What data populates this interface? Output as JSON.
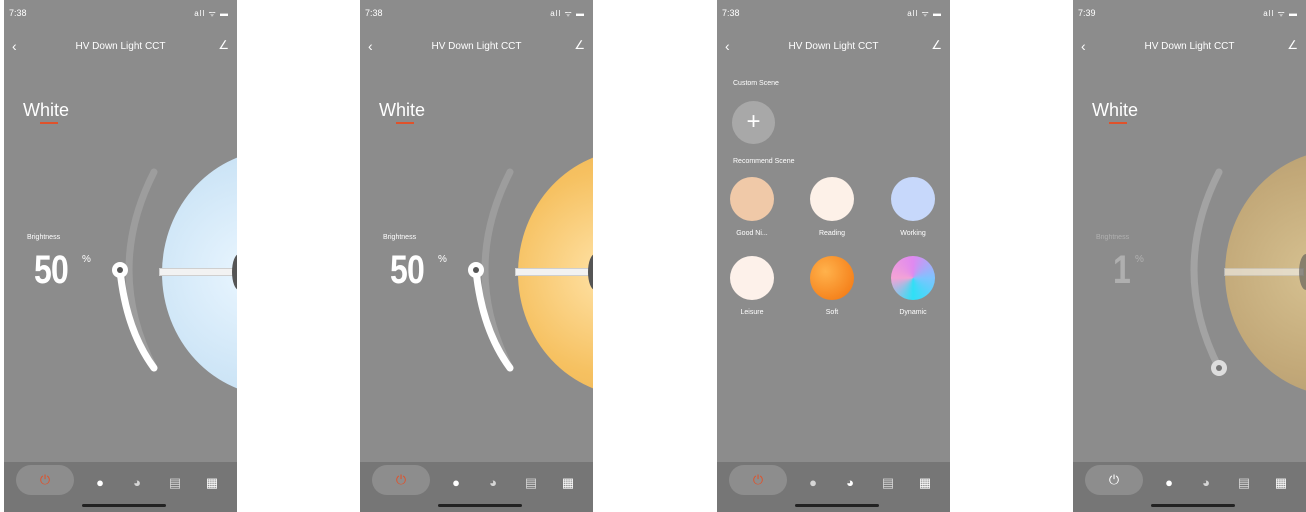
{
  "screens": [
    {
      "status": {
        "time": "7:38",
        "icons": "all ᯤ ▬"
      },
      "nav": {
        "back": "‹",
        "title": "HV  Down Light  CCT",
        "edit": "∠"
      },
      "mode": "White",
      "brightness": {
        "label": "Brightness",
        "value": "50",
        "unit": "%"
      },
      "bulb_color": "#d9ecf8",
      "tabs": [
        "power-icon",
        "bulb-icon",
        "palette-icon",
        "schedule-icon",
        "grid-icon"
      ]
    },
    {
      "status": {
        "time": "7:38",
        "icons": "all ᯤ ▬"
      },
      "nav": {
        "back": "‹",
        "title": "HV  Down Light  CCT",
        "edit": "∠"
      },
      "mode": "White",
      "brightness": {
        "label": "Brightness",
        "value": "50",
        "unit": "%"
      },
      "bulb_color": "#f8c96e",
      "tabs": [
        "power-icon",
        "bulb-icon",
        "palette-icon",
        "schedule-icon",
        "grid-icon"
      ]
    },
    {
      "status": {
        "time": "7:38",
        "icons": "all ᯤ ▬"
      },
      "nav": {
        "back": "‹",
        "title": "HV  Down Light  CCT",
        "edit": "∠"
      },
      "custom_scene_label": "Custom Scene",
      "add_button": "+",
      "recommend_scene_label": "Recommend Scene",
      "scenes": [
        {
          "name": "Good Ni...",
          "color": "#f0c9a8"
        },
        {
          "name": "Reading",
          "color": "#fdf1e8"
        },
        {
          "name": "Working",
          "color": "#c7d8fb"
        },
        {
          "name": "Leisure",
          "color": "#fdf1ea"
        },
        {
          "name": "Soft",
          "color": "#f7801c"
        },
        {
          "name": "Dynamic",
          "color": "#e089f0"
        }
      ],
      "tabs": [
        "power-icon",
        "bulb-icon",
        "palette-icon",
        "schedule-icon",
        "grid-icon"
      ]
    },
    {
      "status": {
        "time": "7:39",
        "icons": "all ᯤ ▬"
      },
      "nav": {
        "back": "‹",
        "title": "HV  Down Light  CCT",
        "edit": "∠"
      },
      "mode": "White",
      "brightness": {
        "label": "Brightness",
        "value": "1",
        "unit": "%"
      },
      "bulb_color": "#c9b283",
      "tabs": [
        "power-icon",
        "bulb-icon",
        "palette-icon",
        "schedule-icon",
        "grid-icon"
      ]
    }
  ],
  "colors": {
    "accent": "#e0522b",
    "background": "#8c8c8c",
    "tabbar": "#767676"
  }
}
